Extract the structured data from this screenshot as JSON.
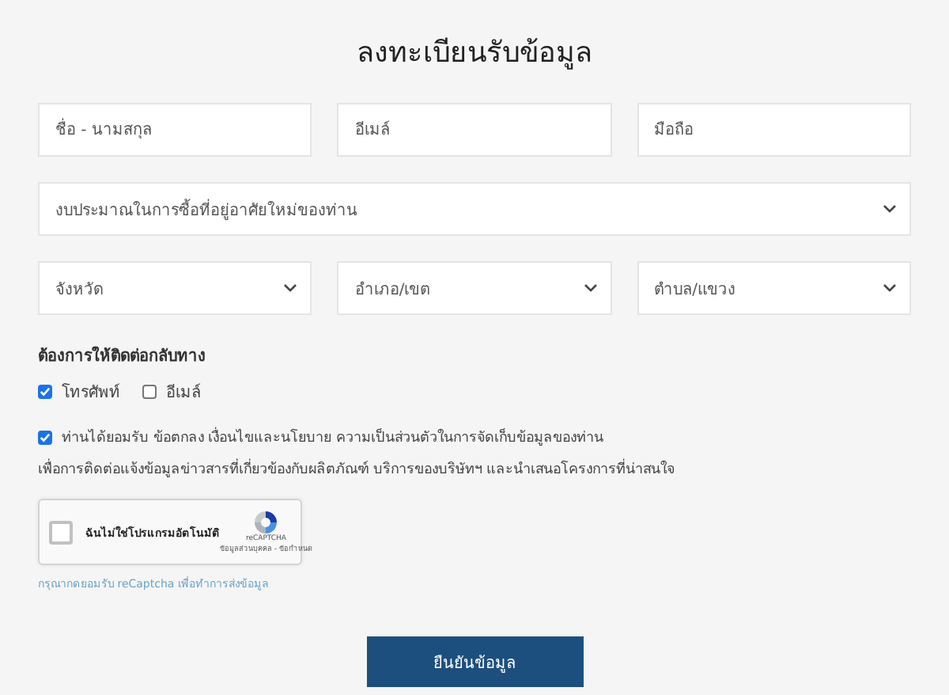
{
  "title": "ลงทะเบียนรับข้อมูล",
  "fields": [
    {
      "kind": "input",
      "placeholder": "ชื่อ - นามสกุล"
    },
    {
      "kind": "input",
      "placeholder": "อีเมล์"
    },
    {
      "kind": "input",
      "placeholder": "มือถือ"
    },
    {
      "kind": "select",
      "placeholder": "งบประมาณในการซื้อที่อยู่อาศัยใหม่ของท่าน",
      "wide": true
    },
    {
      "kind": "select",
      "placeholder": "จังหวัด"
    },
    {
      "kind": "select",
      "placeholder": "อำเภอ/เขต"
    },
    {
      "kind": "select",
      "placeholder": "ตำบล/แขวง"
    }
  ],
  "contact": {
    "label": "ต้องการให้ติดต่อกลับทาง",
    "options": [
      {
        "label": "โทรศัพท์",
        "checked": true
      },
      {
        "label": "อีเมล์",
        "checked": false
      }
    ]
  },
  "consent": {
    "checked": true,
    "text": "ท่านได้ยอมรับ ข้อตกลง เงื่อนไขและนโยบาย ความเป็นส่วนตัวในการจัดเก็บข้อมูลของท่าน",
    "note": "เพื่อการติดต่อแจ้งข้อมูลข่าวสารที่เกี่ยวข้องกับผลิตภัณฑ์ บริการของบริษัทฯ และนำเสนอโครงการที่น่าสนใจ"
  },
  "captcha": {
    "checked": false,
    "label": "ฉันไม่ใช่โปรแกรมอัตโนมัติ",
    "brand": "reCAPTCHA",
    "links": "ข้อมูลส่วนบุคคล - ข้อกำหนด"
  },
  "captcha_hint": "กรุณากดยอมรับ reCaptcha เพื่อทำการส่งข้อมูล",
  "submit": "ยืนยันข้อมูล"
}
